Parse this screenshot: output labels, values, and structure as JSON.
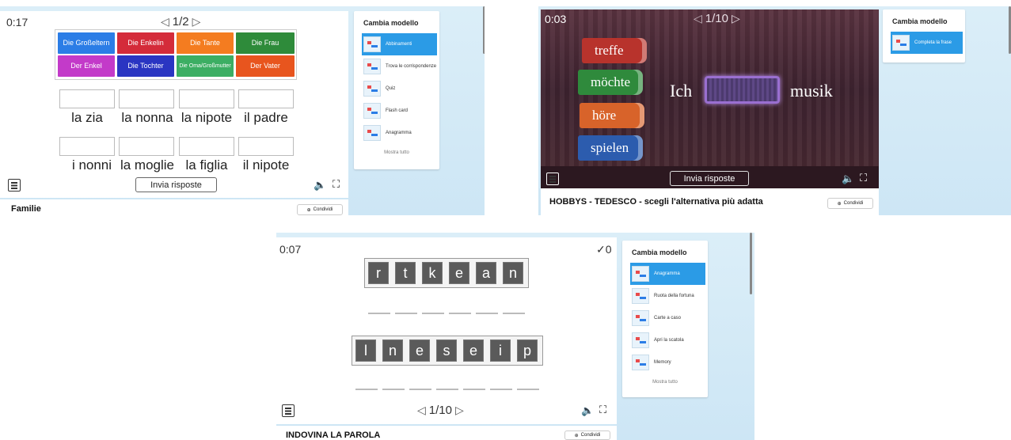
{
  "panel1": {
    "timer": "0:17",
    "page": "1/2",
    "tiles": [
      {
        "label": "Die Großeltern",
        "color": "#2b7de6"
      },
      {
        "label": "Die Enkelin",
        "color": "#d42b3a"
      },
      {
        "label": "Die Tante",
        "color": "#f47c20"
      },
      {
        "label": "Die Frau",
        "color": "#2e8b3a"
      },
      {
        "label": "Der Enkel",
        "color": "#c33ac9"
      },
      {
        "label": "Die Tochter",
        "color": "#2a35c2"
      },
      {
        "label": "Die Oma/Großmutter",
        "color": "#3cae63"
      },
      {
        "label": "Der Vater",
        "color": "#e8551e"
      }
    ],
    "words_row1": [
      "la zia",
      "la nonna",
      "la nipote",
      "il padre"
    ],
    "words_row2": [
      "i nonni",
      "la moglie",
      "la figlia",
      "il nipote"
    ],
    "submit_label": "Invia risposte",
    "title": "Familie",
    "share_label": "Condividi",
    "sidebar": {
      "heading": "Cambia modello",
      "items": [
        "Abbinamenti",
        "Trova le corrispondenze",
        "Quiz",
        "Flash card",
        "Anagramma"
      ],
      "more": "Mostra tutto"
    }
  },
  "panel2": {
    "timer": "0:03",
    "page": "1/10",
    "books": [
      {
        "label": "treffe",
        "color": "#b8332c"
      },
      {
        "label": "möchte",
        "color": "#2f8a3c"
      },
      {
        "label": "höre",
        "color": "#d8632a"
      },
      {
        "label": "spielen",
        "color": "#2c5cae"
      }
    ],
    "sentence_start": "Ich",
    "sentence_end": "musik",
    "submit_label": "Invia risposte",
    "title": "HOBBYS - TEDESCO - scegli l'alternativa più adatta",
    "share_label": "Condividi",
    "sidebar": {
      "heading": "Cambia modello",
      "items": [
        "Completa la frase"
      ]
    }
  },
  "panel3": {
    "timer": "0:07",
    "score": "✓0",
    "word1": [
      "r",
      "t",
      "k",
      "e",
      "a",
      "n"
    ],
    "word2": [
      "l",
      "n",
      "e",
      "s",
      "e",
      "i",
      "p"
    ],
    "page": "1/10",
    "title": "INDOVINA LA PAROLA",
    "share_label": "Condividi",
    "sidebar": {
      "heading": "Cambia modello",
      "items": [
        "Anagramma",
        "Ruota della fortuna",
        "Carte a caso",
        "Apri la scatola",
        "Memory"
      ],
      "more": "Mostra tutto"
    }
  }
}
